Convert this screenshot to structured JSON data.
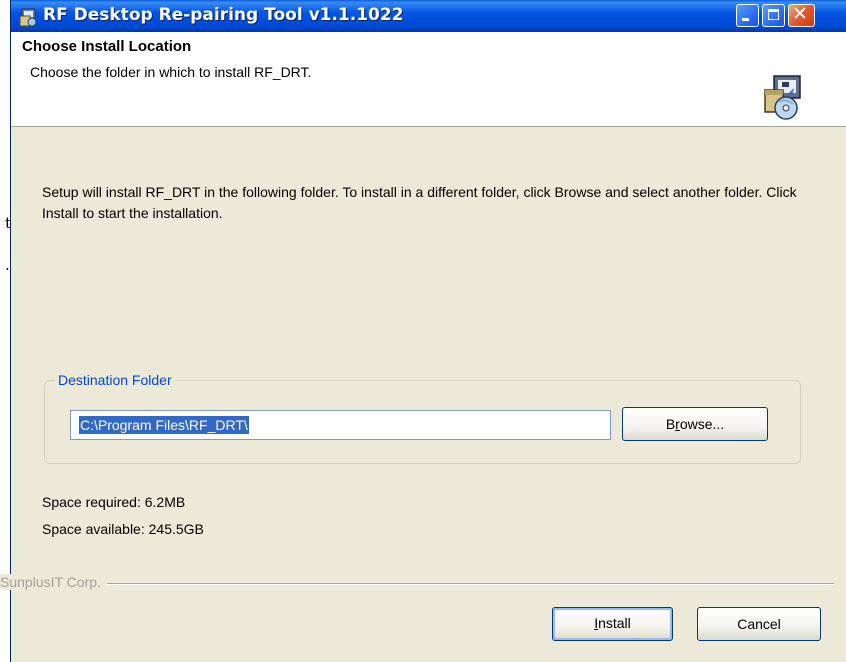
{
  "background": {
    "stray_chars": [
      "t",
      "."
    ]
  },
  "window": {
    "title": "RF Desktop Re-pairing Tool v1.1.1022",
    "controls": {
      "minimize_icon": "minimize-icon",
      "maximize_icon": "maximize-icon",
      "close_icon": "close-icon",
      "close_glyph": "✕"
    },
    "colors": {
      "titlebar": "#0054e3",
      "close_button": "#e05a30",
      "dialog_bg": "#ece9d8",
      "group_label": "#0046d5",
      "selection": "#316ac5"
    }
  },
  "header": {
    "title": "Choose Install Location",
    "subtitle": "Choose the folder in which to install RF_DRT.",
    "icon": "installer-icon"
  },
  "body": {
    "instructions": "Setup will install RF_DRT in the following folder. To install in a different folder, click Browse and select another folder. Click Install to start the installation."
  },
  "destination": {
    "group_label": "Destination Folder",
    "path_value": "C:\\Program Files\\RF_DRT\\",
    "browse_prefix": "B",
    "browse_mnemonic": "r",
    "browse_suffix": "owse..."
  },
  "space": {
    "required": "Space required: 6.2MB",
    "available": "Space available: 245.5GB"
  },
  "footer": {
    "brand": "SunplusIT Corp.",
    "install_mnemonic": "I",
    "install_suffix": "nstall",
    "cancel_label": "Cancel"
  }
}
